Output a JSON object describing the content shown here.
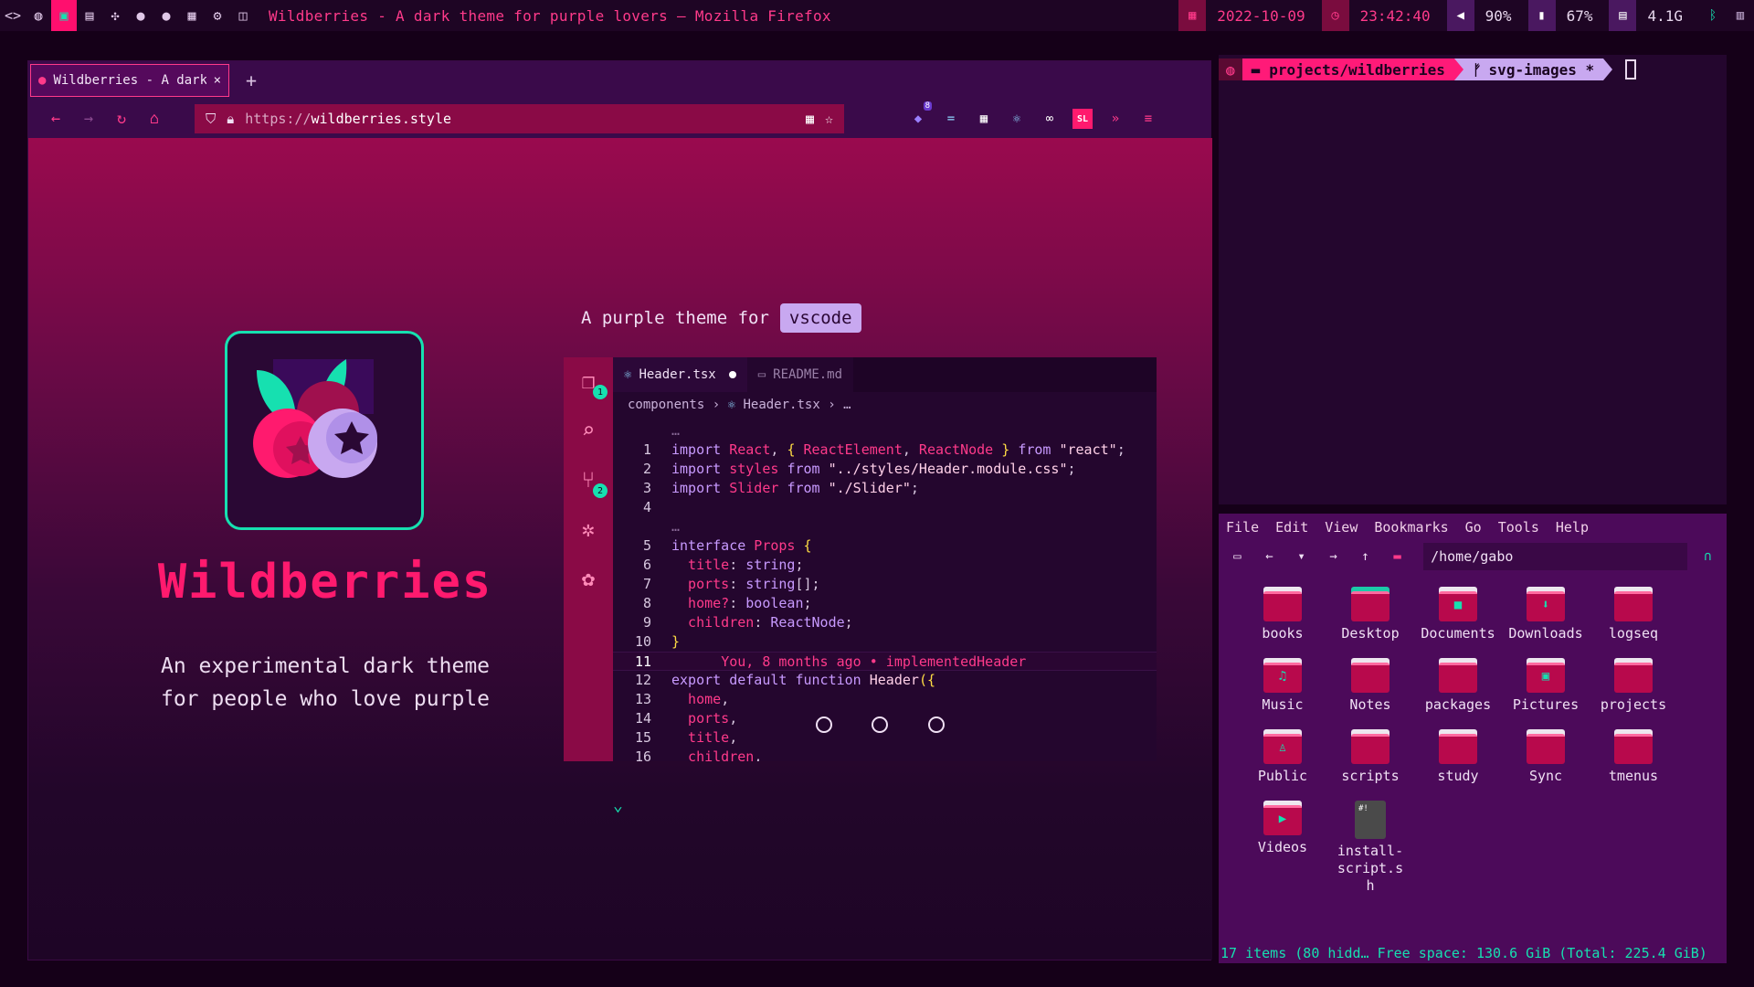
{
  "topbar": {
    "window_title": "Wildberries - A dark theme for purple lovers — Mozilla Firefox",
    "date": "2022-10-09",
    "time": "23:42:40",
    "volume": "90%",
    "battery": "67%",
    "memory": "4.1G"
  },
  "browser": {
    "tab_label": "Wildberries - A dark theme for purple lovers",
    "url_proto": "https://",
    "url_host": "wildberries.style",
    "extension_badge": "8"
  },
  "page": {
    "brand": "Wildberries",
    "tagline_line1": "An experimental dark theme",
    "tagline_line2": "for people who love purple",
    "subtitle_prefix": "A purple theme for",
    "subtitle_chip": "vscode"
  },
  "vscode": {
    "tab_active": "Header.tsx",
    "tab_inactive": "README.md",
    "explorer_badge": "1",
    "scm_badge": "2",
    "crumb_folder": "components",
    "crumb_file": "Header.tsx",
    "crumb_more": "…",
    "blame": "You, 8 months ago • implementedHeader"
  },
  "terminal": {
    "path": "projects/wildberries",
    "branch": "svg-images *"
  },
  "filemanager": {
    "menu": [
      "File",
      "Edit",
      "View",
      "Bookmarks",
      "Go",
      "Tools",
      "Help"
    ],
    "path": "/home/gabo",
    "items": [
      {
        "name": "books",
        "glyph": ""
      },
      {
        "name": "Desktop",
        "glyph": ""
      },
      {
        "name": "Documents",
        "glyph": "■"
      },
      {
        "name": "Downloads",
        "glyph": "⬇"
      },
      {
        "name": "logseq",
        "glyph": ""
      },
      {
        "name": "Music",
        "glyph": "♫"
      },
      {
        "name": "Notes",
        "glyph": ""
      },
      {
        "name": "packages",
        "glyph": ""
      },
      {
        "name": "Pictures",
        "glyph": "▣"
      },
      {
        "name": "projects",
        "glyph": ""
      },
      {
        "name": "Public",
        "glyph": "♙"
      },
      {
        "name": "scripts",
        "glyph": ""
      },
      {
        "name": "study",
        "glyph": ""
      },
      {
        "name": "Sync",
        "glyph": ""
      },
      {
        "name": "tmenus",
        "glyph": ""
      },
      {
        "name": "Videos",
        "glyph": "▶"
      }
    ],
    "file_item": "install-script.sh",
    "status": "17 items (80 hidd… Free space: 130.6 GiB (Total: 225.4 GiB)"
  }
}
